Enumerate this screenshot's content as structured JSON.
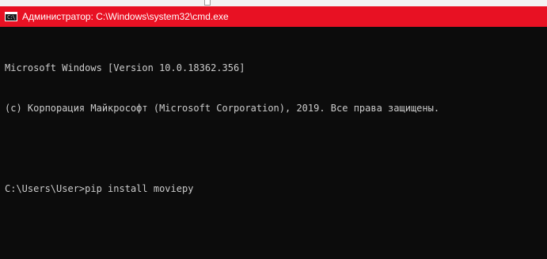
{
  "window": {
    "title": "Администратор: C:\\Windows\\system32\\cmd.exe",
    "icon": "cmd-icon",
    "icon_text": "C:\\",
    "titlebar_color": "#e81123",
    "background_color": "#0c0c0c",
    "text_color": "#cccccc"
  },
  "console": {
    "lines": [
      "Microsoft Windows [Version 10.0.18362.356]",
      "(c) Корпорация Майкрософт (Microsoft Corporation), 2019. Все права защищены.",
      "",
      "C:\\Users\\User>pip install moviepy"
    ]
  }
}
